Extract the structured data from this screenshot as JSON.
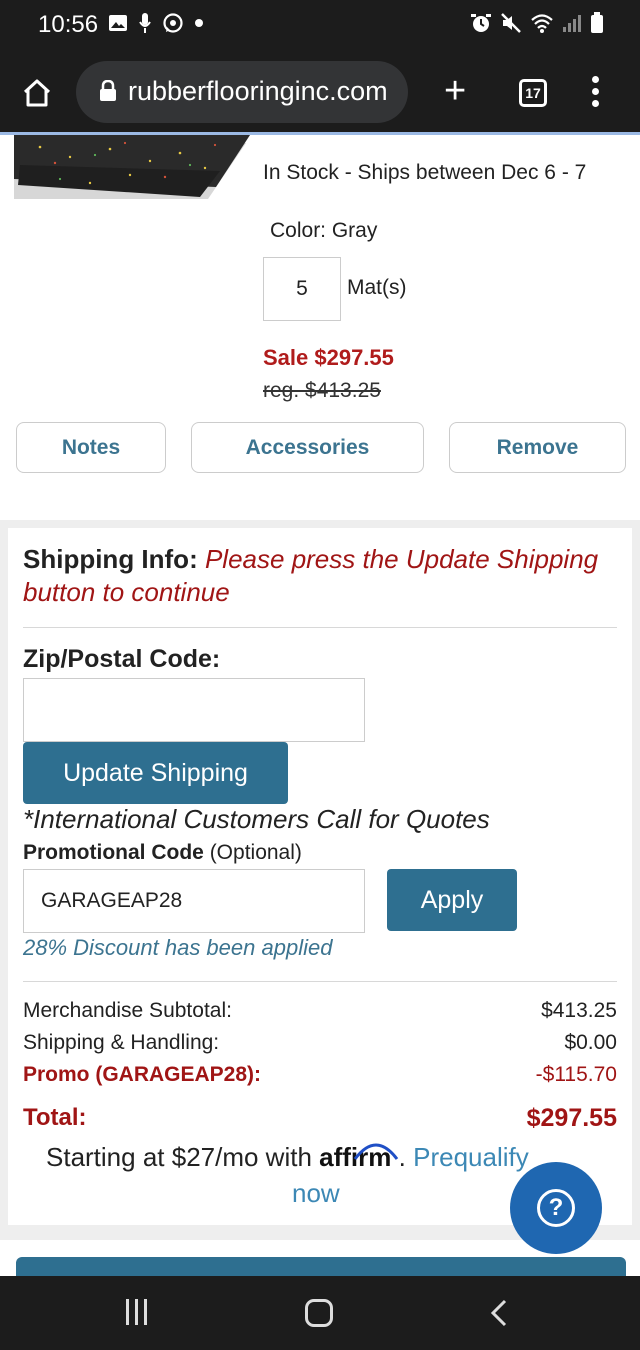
{
  "status_bar": {
    "time": "10:56",
    "left_icons": [
      "gallery-icon",
      "mic-icon",
      "whatsapp-icon",
      "dot-icon"
    ],
    "right_icons": [
      "alarm-icon",
      "mute-icon",
      "wifi-icon",
      "signal-icon",
      "battery-icon"
    ]
  },
  "browser": {
    "url": "rubberflooringinc.com",
    "tab_count": "17"
  },
  "product": {
    "stock": "In Stock - Ships between Dec 6 - 7",
    "color": "Color: Gray",
    "quantity": "5",
    "unit": "Mat(s)",
    "sale_price": "Sale $297.55",
    "reg_price": "reg. $413.25"
  },
  "actions": {
    "notes": "Notes",
    "accessories": "Accessories",
    "remove": "Remove"
  },
  "shipping": {
    "label": "Shipping Info:",
    "message": "Please press the Update Shipping button to continue",
    "zip_label": "Zip/Postal Code:",
    "zip_value": "",
    "update_button": "Update Shipping",
    "intl_note": "*International Customers Call for Quotes"
  },
  "promo": {
    "label": "Promotional Code",
    "optional": "(Optional)",
    "code": "GARAGEAP28",
    "apply_button": "Apply",
    "discount_message": "28% Discount has been applied"
  },
  "summary": {
    "subtotal_label": "Merchandise Subtotal:",
    "subtotal_value": "$413.25",
    "shipping_label": "Shipping & Handling:",
    "shipping_value": "$0.00",
    "promo_label": "Promo (GARAGEAP28):",
    "promo_value": "-$115.70",
    "total_label": "Total:",
    "total_value": "$297.55"
  },
  "financing": {
    "prefix": "Starting at $27/mo with",
    "brand": "affirm",
    "separator": ".",
    "link": "Prequalify",
    "link_tail": "now"
  },
  "colors": {
    "accent": "#2e6f90",
    "sale_red": "#b01c1c",
    "help_blue": "#1f67b1",
    "link_blue": "#3c88b5"
  }
}
